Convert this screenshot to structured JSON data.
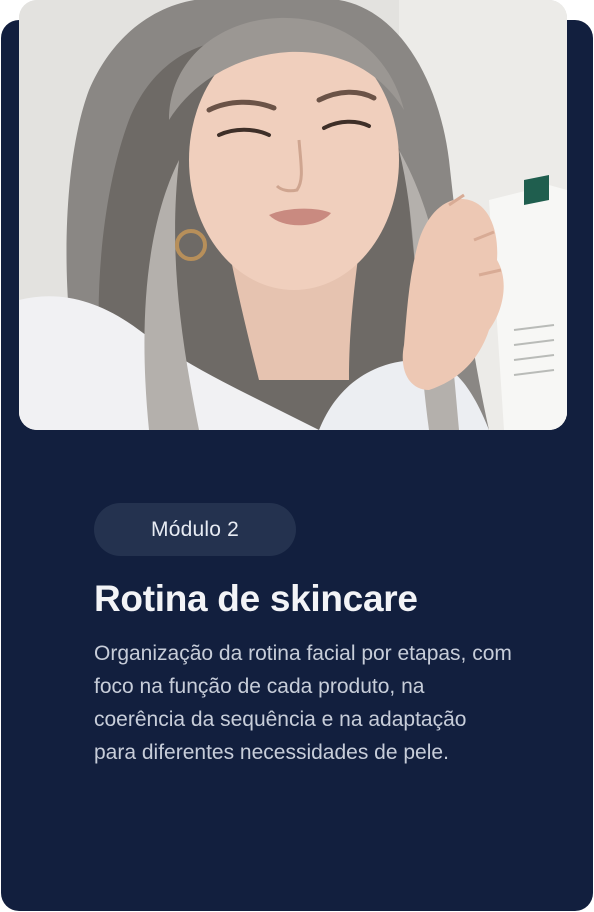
{
  "module": {
    "badge_label": "Módulo 2",
    "title": "Rotina de skincare",
    "description": "Organização da rotina facial por etapas, com foco na função de cada produto, na coerência da sequência e na adaptação para diferentes necessidades de pele."
  },
  "colors": {
    "card_background": "#121f3e",
    "badge_background": "#24324f",
    "title_text": "#f3f4f7",
    "body_text": "#c7cdd9"
  },
  "image": {
    "subject": "woman with long grey hair reading a skincare product package"
  }
}
